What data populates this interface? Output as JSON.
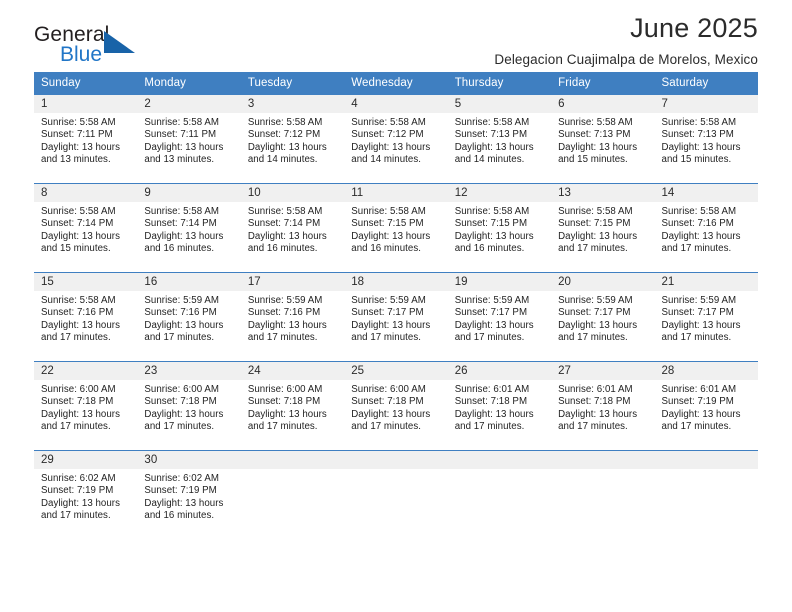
{
  "brand": {
    "name_part1": "General",
    "name_part2": "Blue",
    "sail_icon": "sail-triangle-icon",
    "accent_color": "#2176c7"
  },
  "header": {
    "title": "June 2025",
    "subtitle": "Delegacion Cuajimalpa de Morelos, Mexico"
  },
  "colors": {
    "header_row_bg": "#3f7fc1",
    "header_row_text": "#ffffff",
    "daynum_band_bg": "#f0f0f0",
    "row_divider": "#3f7fc1",
    "body_text": "#232323"
  },
  "weekday_headers": [
    "Sunday",
    "Monday",
    "Tuesday",
    "Wednesday",
    "Thursday",
    "Friday",
    "Saturday"
  ],
  "weeks": [
    [
      {
        "day": "1",
        "lines": [
          "Sunrise: 5:58 AM",
          "Sunset: 7:11 PM",
          "Daylight: 13 hours",
          "and 13 minutes."
        ]
      },
      {
        "day": "2",
        "lines": [
          "Sunrise: 5:58 AM",
          "Sunset: 7:11 PM",
          "Daylight: 13 hours",
          "and 13 minutes."
        ]
      },
      {
        "day": "3",
        "lines": [
          "Sunrise: 5:58 AM",
          "Sunset: 7:12 PM",
          "Daylight: 13 hours",
          "and 14 minutes."
        ]
      },
      {
        "day": "4",
        "lines": [
          "Sunrise: 5:58 AM",
          "Sunset: 7:12 PM",
          "Daylight: 13 hours",
          "and 14 minutes."
        ]
      },
      {
        "day": "5",
        "lines": [
          "Sunrise: 5:58 AM",
          "Sunset: 7:13 PM",
          "Daylight: 13 hours",
          "and 14 minutes."
        ]
      },
      {
        "day": "6",
        "lines": [
          "Sunrise: 5:58 AM",
          "Sunset: 7:13 PM",
          "Daylight: 13 hours",
          "and 15 minutes."
        ]
      },
      {
        "day": "7",
        "lines": [
          "Sunrise: 5:58 AM",
          "Sunset: 7:13 PM",
          "Daylight: 13 hours",
          "and 15 minutes."
        ]
      }
    ],
    [
      {
        "day": "8",
        "lines": [
          "Sunrise: 5:58 AM",
          "Sunset: 7:14 PM",
          "Daylight: 13 hours",
          "and 15 minutes."
        ]
      },
      {
        "day": "9",
        "lines": [
          "Sunrise: 5:58 AM",
          "Sunset: 7:14 PM",
          "Daylight: 13 hours",
          "and 16 minutes."
        ]
      },
      {
        "day": "10",
        "lines": [
          "Sunrise: 5:58 AM",
          "Sunset: 7:14 PM",
          "Daylight: 13 hours",
          "and 16 minutes."
        ]
      },
      {
        "day": "11",
        "lines": [
          "Sunrise: 5:58 AM",
          "Sunset: 7:15 PM",
          "Daylight: 13 hours",
          "and 16 minutes."
        ]
      },
      {
        "day": "12",
        "lines": [
          "Sunrise: 5:58 AM",
          "Sunset: 7:15 PM",
          "Daylight: 13 hours",
          "and 16 minutes."
        ]
      },
      {
        "day": "13",
        "lines": [
          "Sunrise: 5:58 AM",
          "Sunset: 7:15 PM",
          "Daylight: 13 hours",
          "and 17 minutes."
        ]
      },
      {
        "day": "14",
        "lines": [
          "Sunrise: 5:58 AM",
          "Sunset: 7:16 PM",
          "Daylight: 13 hours",
          "and 17 minutes."
        ]
      }
    ],
    [
      {
        "day": "15",
        "lines": [
          "Sunrise: 5:58 AM",
          "Sunset: 7:16 PM",
          "Daylight: 13 hours",
          "and 17 minutes."
        ]
      },
      {
        "day": "16",
        "lines": [
          "Sunrise: 5:59 AM",
          "Sunset: 7:16 PM",
          "Daylight: 13 hours",
          "and 17 minutes."
        ]
      },
      {
        "day": "17",
        "lines": [
          "Sunrise: 5:59 AM",
          "Sunset: 7:16 PM",
          "Daylight: 13 hours",
          "and 17 minutes."
        ]
      },
      {
        "day": "18",
        "lines": [
          "Sunrise: 5:59 AM",
          "Sunset: 7:17 PM",
          "Daylight: 13 hours",
          "and 17 minutes."
        ]
      },
      {
        "day": "19",
        "lines": [
          "Sunrise: 5:59 AM",
          "Sunset: 7:17 PM",
          "Daylight: 13 hours",
          "and 17 minutes."
        ]
      },
      {
        "day": "20",
        "lines": [
          "Sunrise: 5:59 AM",
          "Sunset: 7:17 PM",
          "Daylight: 13 hours",
          "and 17 minutes."
        ]
      },
      {
        "day": "21",
        "lines": [
          "Sunrise: 5:59 AM",
          "Sunset: 7:17 PM",
          "Daylight: 13 hours",
          "and 17 minutes."
        ]
      }
    ],
    [
      {
        "day": "22",
        "lines": [
          "Sunrise: 6:00 AM",
          "Sunset: 7:18 PM",
          "Daylight: 13 hours",
          "and 17 minutes."
        ]
      },
      {
        "day": "23",
        "lines": [
          "Sunrise: 6:00 AM",
          "Sunset: 7:18 PM",
          "Daylight: 13 hours",
          "and 17 minutes."
        ]
      },
      {
        "day": "24",
        "lines": [
          "Sunrise: 6:00 AM",
          "Sunset: 7:18 PM",
          "Daylight: 13 hours",
          "and 17 minutes."
        ]
      },
      {
        "day": "25",
        "lines": [
          "Sunrise: 6:00 AM",
          "Sunset: 7:18 PM",
          "Daylight: 13 hours",
          "and 17 minutes."
        ]
      },
      {
        "day": "26",
        "lines": [
          "Sunrise: 6:01 AM",
          "Sunset: 7:18 PM",
          "Daylight: 13 hours",
          "and 17 minutes."
        ]
      },
      {
        "day": "27",
        "lines": [
          "Sunrise: 6:01 AM",
          "Sunset: 7:18 PM",
          "Daylight: 13 hours",
          "and 17 minutes."
        ]
      },
      {
        "day": "28",
        "lines": [
          "Sunrise: 6:01 AM",
          "Sunset: 7:19 PM",
          "Daylight: 13 hours",
          "and 17 minutes."
        ]
      }
    ],
    [
      {
        "day": "29",
        "lines": [
          "Sunrise: 6:02 AM",
          "Sunset: 7:19 PM",
          "Daylight: 13 hours",
          "and 17 minutes."
        ]
      },
      {
        "day": "30",
        "lines": [
          "Sunrise: 6:02 AM",
          "Sunset: 7:19 PM",
          "Daylight: 13 hours",
          "and 16 minutes."
        ]
      },
      {
        "day": "",
        "lines": []
      },
      {
        "day": "",
        "lines": []
      },
      {
        "day": "",
        "lines": []
      },
      {
        "day": "",
        "lines": []
      },
      {
        "day": "",
        "lines": []
      }
    ]
  ]
}
